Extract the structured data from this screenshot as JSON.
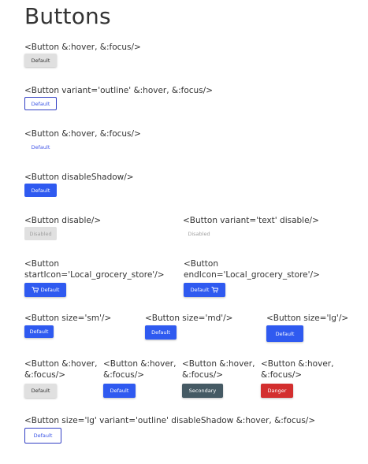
{
  "page": {
    "title": "Buttons"
  },
  "sections": {
    "default_hover": {
      "label": "<Button &:hover, &:focus/>",
      "button": "Default"
    },
    "outline": {
      "label": "<Button variant='outline' &:hover, &:focus/>",
      "button": "Default"
    },
    "text_hover": {
      "label": "<Button &:hover, &:focus/>",
      "button": "Default"
    },
    "disable_shadow": {
      "label": "<Button disableShadow/>",
      "button": "Default"
    },
    "disable": {
      "label": "<Button disable/>",
      "button": "Disabled"
    },
    "text_disable": {
      "label": "<Button variant='text' disable/>",
      "button": "Disabled"
    },
    "start_icon": {
      "label": "<Button startIcon='Local_grocery_store'/>",
      "button": "Default",
      "icon": "cart-icon"
    },
    "end_icon": {
      "label": "<Button endIcon='Local_grocery_store'/>",
      "button": "Default",
      "icon": "cart-icon"
    },
    "size_sm": {
      "label": "<Button size='sm'/>",
      "button": "Default"
    },
    "size_md": {
      "label": "<Button size='md'/>",
      "button": "Default"
    },
    "size_lg": {
      "label": "<Button size='lg'/>",
      "button": "Default"
    },
    "color_default": {
      "label": "<Button &:hover, &:focus/>",
      "button": "Default"
    },
    "color_primary": {
      "label": "<Button &:hover, &:focus/>",
      "button": "Default"
    },
    "color_secondary": {
      "label": "<Button &:hover, &:focus/>",
      "button": "Secondary"
    },
    "color_danger": {
      "label": "<Button &:hover, &:focus/>",
      "button": "Danger"
    },
    "lg_outline": {
      "label": "<Button size='lg' variant='outline' disableShadow &:hover, &:focus/>",
      "button": "Default"
    }
  },
  "colors": {
    "primary": "#2f5af0",
    "secondary": "#455a64",
    "danger": "#d32f2f",
    "default": "#e0e0e0",
    "outline_border": "#3340c4"
  }
}
